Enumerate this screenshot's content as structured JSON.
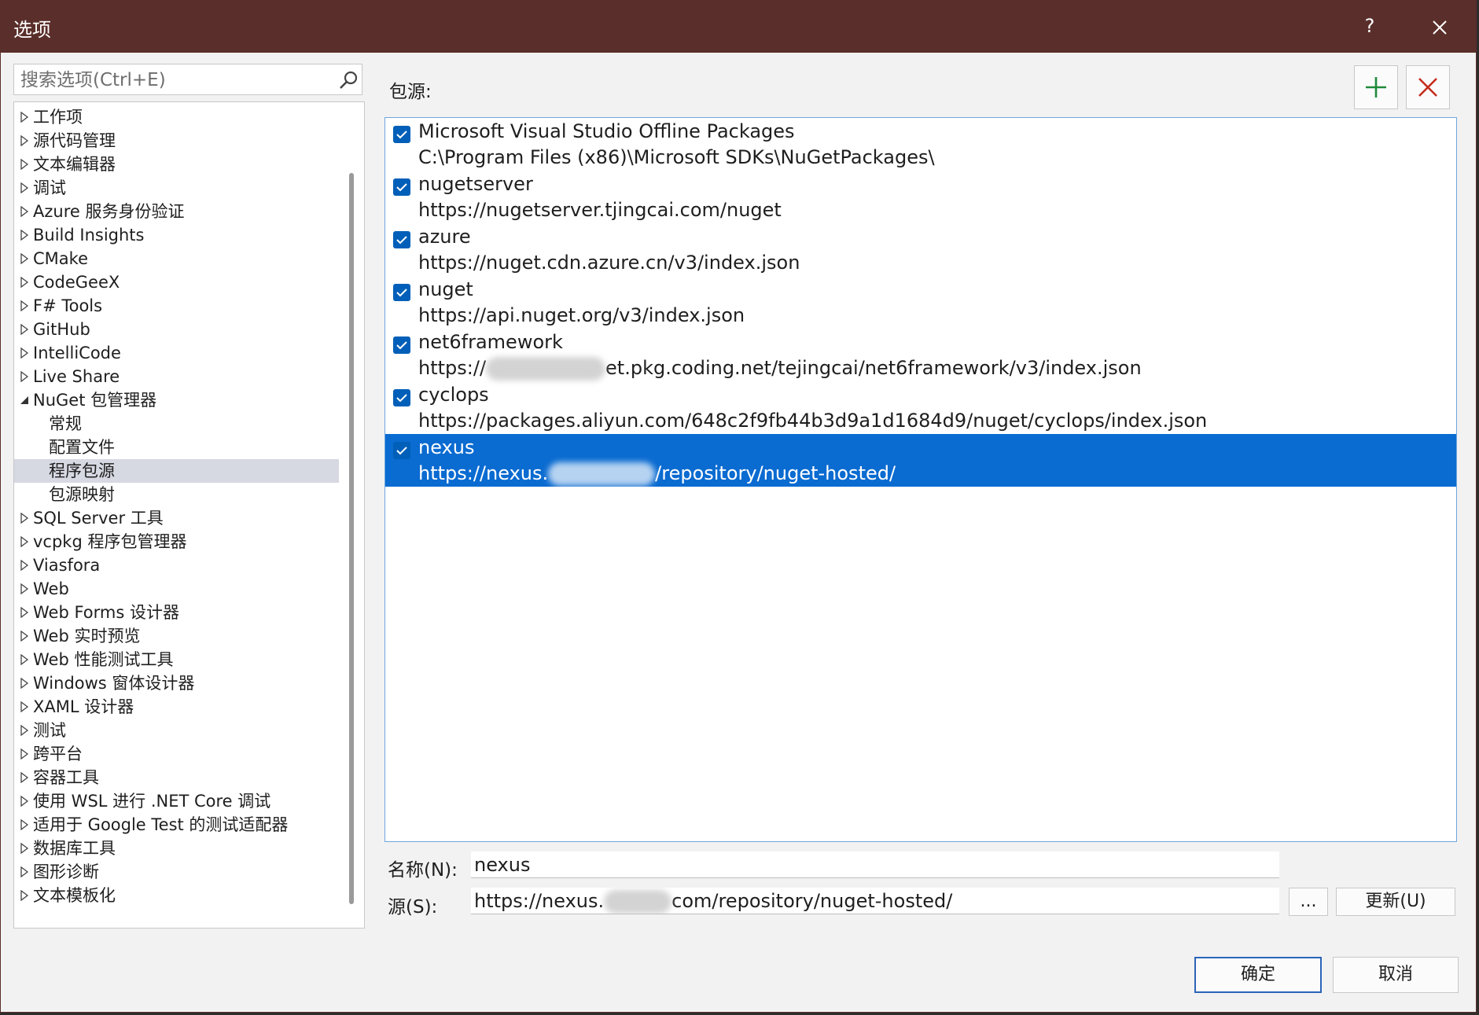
{
  "window": {
    "title": "选项",
    "help_label": "?"
  },
  "search": {
    "placeholder": "搜索选项(Ctrl+E)"
  },
  "tree": {
    "items": [
      {
        "label": "工作项",
        "expandable": true
      },
      {
        "label": "源代码管理",
        "expandable": true
      },
      {
        "label": "文本编辑器",
        "expandable": true
      },
      {
        "label": "调试",
        "expandable": true
      },
      {
        "label": "Azure 服务身份验证",
        "expandable": true
      },
      {
        "label": "Build Insights",
        "expandable": true
      },
      {
        "label": "CMake",
        "expandable": true
      },
      {
        "label": "CodeGeeX",
        "expandable": true
      },
      {
        "label": "F# Tools",
        "expandable": true
      },
      {
        "label": "GitHub",
        "expandable": true
      },
      {
        "label": "IntelliCode",
        "expandable": true
      },
      {
        "label": "Live Share",
        "expandable": true
      },
      {
        "label": "NuGet 包管理器",
        "expanded": true
      },
      {
        "label": "常规",
        "child": true
      },
      {
        "label": "配置文件",
        "child": true
      },
      {
        "label": "程序包源",
        "child": true,
        "selected": true
      },
      {
        "label": "包源映射",
        "child": true
      },
      {
        "label": "SQL Server 工具",
        "expandable": true
      },
      {
        "label": "vcpkg 程序包管理器",
        "expandable": true
      },
      {
        "label": "Viasfora",
        "expandable": true
      },
      {
        "label": "Web",
        "expandable": true
      },
      {
        "label": "Web Forms 设计器",
        "expandable": true
      },
      {
        "label": "Web 实时预览",
        "expandable": true
      },
      {
        "label": "Web 性能测试工具",
        "expandable": true
      },
      {
        "label": "Windows 窗体设计器",
        "expandable": true
      },
      {
        "label": "XAML 设计器",
        "expandable": true
      },
      {
        "label": "测试",
        "expandable": true
      },
      {
        "label": "跨平台",
        "expandable": true
      },
      {
        "label": "容器工具",
        "expandable": true
      },
      {
        "label": "使用 WSL 进行 .NET Core 调试",
        "expandable": true
      },
      {
        "label": "适用于 Google Test 的测试适配器",
        "expandable": true
      },
      {
        "label": "数据库工具",
        "expandable": true
      },
      {
        "label": "图形诊断",
        "expandable": true
      },
      {
        "label": "文本模板化",
        "expandable": true
      }
    ]
  },
  "sources": {
    "label": "包源:",
    "items": [
      {
        "name": "Microsoft Visual Studio Offline Packages",
        "url_before": "C:\\Program Files (x86)\\Microsoft SDKs\\NuGetPackages\\",
        "url_after": "",
        "checked": true
      },
      {
        "name": "nugetserver",
        "url_before": "https://nugetserver.tjingcai.com/nuget",
        "url_after": "",
        "checked": true
      },
      {
        "name": "azure",
        "url_before": "https://nuget.cdn.azure.cn/v3/index.json",
        "url_after": "",
        "checked": true
      },
      {
        "name": "nuget",
        "url_before": "https://api.nuget.org/v3/index.json",
        "url_after": "",
        "checked": true
      },
      {
        "name": "net6framework",
        "url_before": "https://",
        "url_after": "et.pkg.coding.net/tejingcai/net6framework/v3/index.json",
        "checked": true,
        "redacted": true
      },
      {
        "name": "cyclops",
        "url_before": "https://packages.aliyun.com/648c2f9fb44b3d9a1d1684d9/nuget/cyclops/index.json",
        "url_after": "",
        "checked": true
      },
      {
        "name": "nexus",
        "url_before": "https://nexus.",
        "url_after": "/repository/nuget-hosted/",
        "checked": true,
        "redacted": true,
        "selected": true
      }
    ]
  },
  "form": {
    "name_label": "名称(N):",
    "name_value": "nexus",
    "source_label": "源(S):",
    "source_before": "https://nexus.",
    "source_after": "com/repository/nuget-hosted/",
    "browse_label": "...",
    "update_label": "更新(U)"
  },
  "footer": {
    "ok_label": "确定",
    "cancel_label": "取消"
  },
  "colors": {
    "titlebar": "#5a2e2a",
    "selection": "#0a6bd1",
    "checkbox": "#005fb8",
    "add_icon": "#1f8a3b",
    "remove_icon": "#c42b1c"
  }
}
